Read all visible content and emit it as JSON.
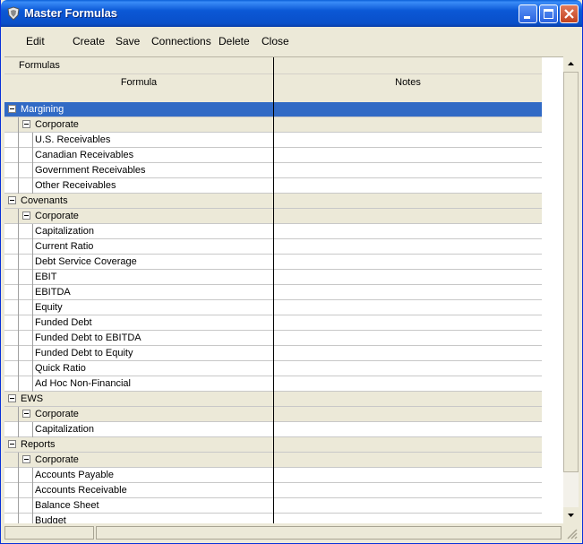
{
  "window": {
    "title": "Master Formulas"
  },
  "menu": [
    "Edit",
    "Create",
    "Save",
    "Connections",
    "Delete",
    "Close"
  ],
  "grid": {
    "group_header": "Formulas",
    "columns": {
      "formula": "Formula",
      "notes": "Notes"
    },
    "rows": [
      {
        "level": 0,
        "label": "Margining",
        "selected": true
      },
      {
        "level": 1,
        "label": "Corporate"
      },
      {
        "level": 2,
        "label": "U.S. Receivables"
      },
      {
        "level": 2,
        "label": "Canadian Receivables"
      },
      {
        "level": 2,
        "label": "Government Receivables"
      },
      {
        "level": 2,
        "label": "Other Receivables"
      },
      {
        "level": 0,
        "label": "Covenants"
      },
      {
        "level": 1,
        "label": "Corporate"
      },
      {
        "level": 2,
        "label": "Capitalization"
      },
      {
        "level": 2,
        "label": "Current Ratio"
      },
      {
        "level": 2,
        "label": "Debt Service Coverage"
      },
      {
        "level": 2,
        "label": "EBIT"
      },
      {
        "level": 2,
        "label": "EBITDA"
      },
      {
        "level": 2,
        "label": "Equity"
      },
      {
        "level": 2,
        "label": "Funded Debt"
      },
      {
        "level": 2,
        "label": "Funded Debt to EBITDA"
      },
      {
        "level": 2,
        "label": "Funded Debt to Equity"
      },
      {
        "level": 2,
        "label": "Quick Ratio"
      },
      {
        "level": 2,
        "label": "Ad Hoc Non-Financial"
      },
      {
        "level": 0,
        "label": "EWS"
      },
      {
        "level": 1,
        "label": "Corporate"
      },
      {
        "level": 2,
        "label": "Capitalization"
      },
      {
        "level": 0,
        "label": "Reports"
      },
      {
        "level": 1,
        "label": "Corporate"
      },
      {
        "level": 2,
        "label": "Accounts Payable"
      },
      {
        "level": 2,
        "label": "Accounts Receivable"
      },
      {
        "level": 2,
        "label": "Balance Sheet"
      },
      {
        "level": 2,
        "label": "Budget"
      }
    ]
  },
  "colors": {
    "title_blue": "#0a4fc8",
    "selection": "#316ac5",
    "chrome": "#ece9d8"
  }
}
